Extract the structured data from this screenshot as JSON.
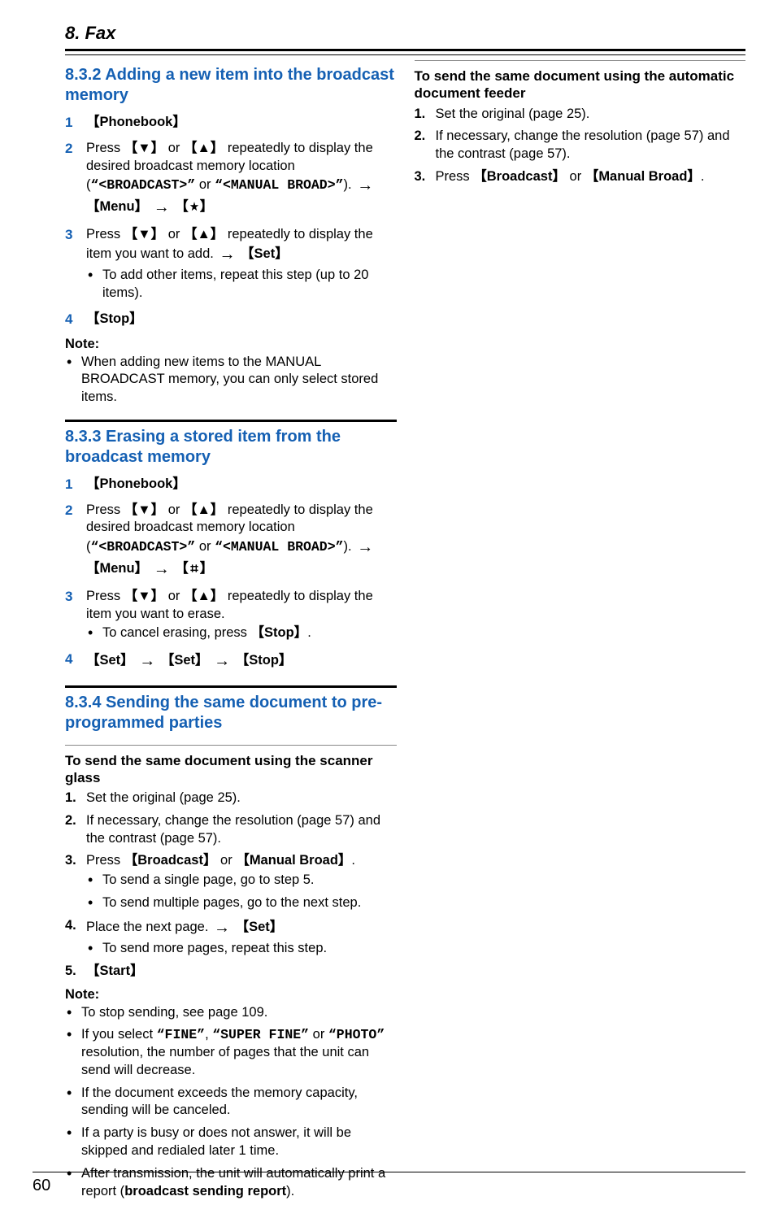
{
  "chapter": "8. Fax",
  "pagenum": "60",
  "s832": {
    "title": "8.3.2 Adding a new item into the broadcast memory",
    "step1": "【Phonebook】",
    "step2_a": "Press ",
    "step2_b": " or ",
    "step2_c": " repeatedly to display the desired broadcast memory location (",
    "step2_code1": "“<BROADCAST>”",
    "step2_d": " or ",
    "step2_code2": "“<MANUAL BROAD>”",
    "step2_e": "). ",
    "step2_menu": "【Menu】",
    "step3_a": "Press ",
    "step3_b": " or ",
    "step3_c": " repeatedly to display the item you want to add. ",
    "step3_set": "【Set】",
    "step3_sub": "To add other items, repeat this step (up to 20 items).",
    "step4": "【Stop】",
    "note_label": "Note:",
    "note1": "When adding new items to the MANUAL BROADCAST memory, you can only select stored items."
  },
  "s833": {
    "title": "8.3.3 Erasing a stored item from the broadcast memory",
    "step1": "【Phonebook】",
    "step2_a": "Press ",
    "step2_b": " or ",
    "step2_c": " repeatedly to display the desired broadcast memory location (",
    "step2_code1": "“<BROADCAST>”",
    "step2_d": " or ",
    "step2_code2": "“<MANUAL BROAD>”",
    "step2_e": "). ",
    "step2_menu": "【Menu】",
    "step3_a": "Press ",
    "step3_b": " or ",
    "step3_c": " repeatedly to display the item you want to erase.",
    "step3_sub_a": "To cancel erasing, press ",
    "step3_sub_stop": "【Stop】",
    "step3_sub_b": ".",
    "step4_set": "【Set】",
    "step4_stop": "【Stop】"
  },
  "s834": {
    "title": "8.3.4 Sending the same document to pre-programmed parties",
    "sub1_title": "To send the same document using the scanner glass",
    "s1": "Set the original (page 25).",
    "s2": "If necessary, change the resolution (page 57) and the contrast (page 57).",
    "s3_a": "Press ",
    "s3_broadcast": "【Broadcast】",
    "s3_b": " or ",
    "s3_manual": "【Manual Broad】",
    "s3_c": ".",
    "s3_sub1": "To send a single page, go to step 5.",
    "s3_sub2": "To send multiple pages, go to the next step.",
    "s4_a": "Place the next page. ",
    "s4_set": "【Set】",
    "s4_sub": "To send more pages, repeat this step.",
    "s5": "【Start】",
    "note_label": "Note:",
    "n1": "To stop sending, see page 109.",
    "n2_a": "If you select ",
    "n2_fine": "“FINE”",
    "n2_b": ", ",
    "n2_sfine": "“SUPER FINE”",
    "n2_c": " or ",
    "n2_photo": "“PHOTO”",
    "n2_d": " resolution, the number of pages that the unit can send will decrease.",
    "n3": "If the document exceeds the memory capacity, sending will be canceled.",
    "n4": "If a party is busy or does not answer, it will be skipped and redialed later 1 time.",
    "n5_a": "After transmission, the unit will automatically print a report (",
    "n5_b": "broadcast sending report",
    "n5_c": ")."
  },
  "right": {
    "title": "To send the same document using the automatic document feeder",
    "s1": "Set the original (page 25).",
    "s2": "If necessary, change the resolution (page 57) and the contrast (page 57).",
    "s3_a": "Press ",
    "s3_broadcast": "【Broadcast】",
    "s3_b": " or ",
    "s3_manual": "【Manual Broad】",
    "s3_c": "."
  },
  "glyph": {
    "down": "【▼】",
    "up": "【▲】",
    "arrow": "→"
  }
}
